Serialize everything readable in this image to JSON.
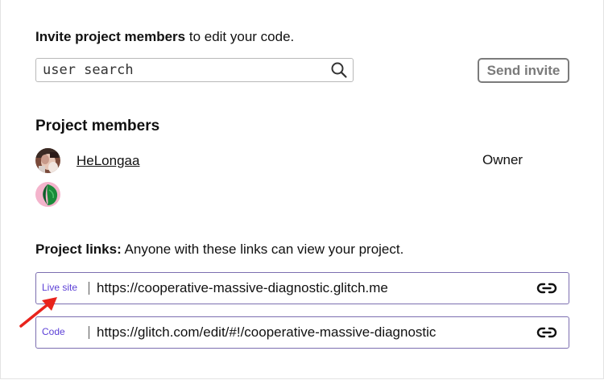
{
  "invite": {
    "heading_bold": "Invite project members",
    "heading_rest": " to edit your code.",
    "search_placeholder": "user search",
    "send_invite_label": "Send invite"
  },
  "members": {
    "heading": "Project members",
    "items": [
      {
        "name": "HeLongaa",
        "role": "Owner",
        "avatar": "avatar-photo"
      },
      {
        "name": "",
        "role": "",
        "avatar": "avatar-green-pink"
      }
    ]
  },
  "links": {
    "heading_bold": "Project links:",
    "heading_rest": " Anyone with these links can view your project.",
    "items": [
      {
        "tag": "Live site",
        "url": "https://cooperative-massive-diagnostic.glitch.me",
        "icon": "link-icon"
      },
      {
        "tag": "Code",
        "url": "https://glitch.com/edit/#!/cooperative-massive-diagnostic",
        "icon": "link-icon"
      }
    ]
  },
  "annotation": {
    "icon": "red-arrow",
    "color": "#e8231c"
  },
  "colors": {
    "link_border": "#7c6fb0",
    "link_tag": "#5b3fd6",
    "button_text": "#7a7a7a"
  }
}
